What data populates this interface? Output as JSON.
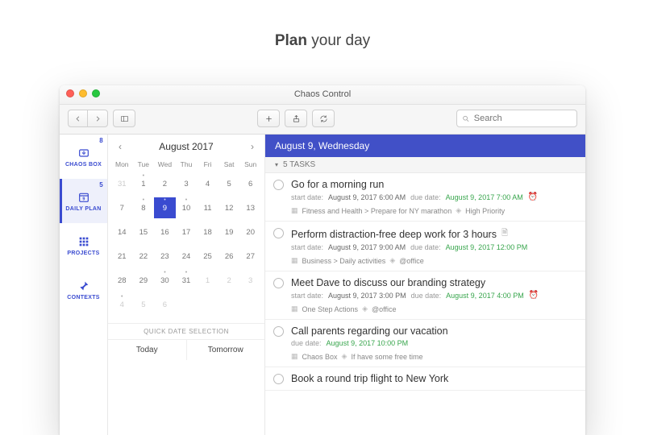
{
  "headline": {
    "bold": "Plan",
    "rest": " your day"
  },
  "window": {
    "title": "Chaos Control",
    "search_placeholder": "Search"
  },
  "nav": [
    {
      "id": "chaos-box",
      "label": "CHAOS BOX",
      "badge": "8",
      "icon": "inbox",
      "active": false
    },
    {
      "id": "daily-plan",
      "label": "DAILY PLAN",
      "badge": "5",
      "icon": "calendar",
      "active": true,
      "calendar_day": "9"
    },
    {
      "id": "projects",
      "label": "PROJECTS",
      "badge": "",
      "icon": "grid",
      "active": false
    },
    {
      "id": "contexts",
      "label": "CONTEXTS",
      "badge": "",
      "icon": "pin",
      "active": false
    }
  ],
  "calendar": {
    "month_label": "August 2017",
    "weekdays": [
      "Mon",
      "Tue",
      "Wed",
      "Thu",
      "Fri",
      "Sat",
      "Sun"
    ],
    "cells": [
      {
        "n": "31",
        "dim": true
      },
      {
        "n": "1",
        "dot": true
      },
      {
        "n": "2"
      },
      {
        "n": "3"
      },
      {
        "n": "4"
      },
      {
        "n": "5"
      },
      {
        "n": "6"
      },
      {
        "n": "7"
      },
      {
        "n": "8",
        "dot": true
      },
      {
        "n": "9",
        "dot": true,
        "selected": true
      },
      {
        "n": "10",
        "dot": true
      },
      {
        "n": "11"
      },
      {
        "n": "12"
      },
      {
        "n": "13"
      },
      {
        "n": "14"
      },
      {
        "n": "15"
      },
      {
        "n": "16"
      },
      {
        "n": "17"
      },
      {
        "n": "18"
      },
      {
        "n": "19"
      },
      {
        "n": "20"
      },
      {
        "n": "21"
      },
      {
        "n": "22"
      },
      {
        "n": "23"
      },
      {
        "n": "24"
      },
      {
        "n": "25"
      },
      {
        "n": "26"
      },
      {
        "n": "27"
      },
      {
        "n": "28"
      },
      {
        "n": "29"
      },
      {
        "n": "30",
        "dot": true
      },
      {
        "n": "31",
        "dot": true
      },
      {
        "n": "1",
        "dim": true
      },
      {
        "n": "2",
        "dim": true
      },
      {
        "n": "3",
        "dim": true
      },
      {
        "n": "4",
        "dim": true,
        "dot": true
      },
      {
        "n": "5",
        "dim": true
      },
      {
        "n": "6",
        "dim": true
      },
      {
        "n": "",
        "dim": true
      },
      {
        "n": "",
        "dim": true
      },
      {
        "n": "",
        "dim": true
      },
      {
        "n": "",
        "dim": true
      }
    ],
    "quick_header": "QUICK DATE SELECTION",
    "quick": [
      "Today",
      "Tomorrow"
    ]
  },
  "tasks_header": "August 9, Wednesday",
  "tasks_count_label": "5 TASKS",
  "tasks": [
    {
      "title": "Go for a morning run",
      "start_label": "start date:",
      "start": "August 9, 2017 6:00 AM",
      "due_label": "due date:",
      "due": "August 9, 2017 7:00 AM",
      "alarm": true,
      "path": "Fitness and Health > Prepare for NY marathon",
      "tag": "High Priority"
    },
    {
      "title": "Perform distraction-free deep work for 3 hours",
      "note_icon": true,
      "start_label": "start date:",
      "start": "August 9, 2017 9:00 AM",
      "due_label": "due date:",
      "due": "August 9, 2017 12:00 PM",
      "path": "Business > Daily activities",
      "tag": "@office"
    },
    {
      "title": "Meet Dave to discuss our branding strategy",
      "start_label": "start date:",
      "start": "August 9, 2017 3:00 PM",
      "due_label": "due date:",
      "due": "August 9, 2017 4:00 PM",
      "alarm": true,
      "path": "One Step Actions",
      "tag": "@office"
    },
    {
      "title": "Call parents regarding our vacation",
      "due_label": "due date:",
      "due": "August 9, 2017 10:00 PM",
      "path": "Chaos Box",
      "tag": "If have some free time"
    },
    {
      "title": "Book a round trip flight to New York"
    }
  ]
}
